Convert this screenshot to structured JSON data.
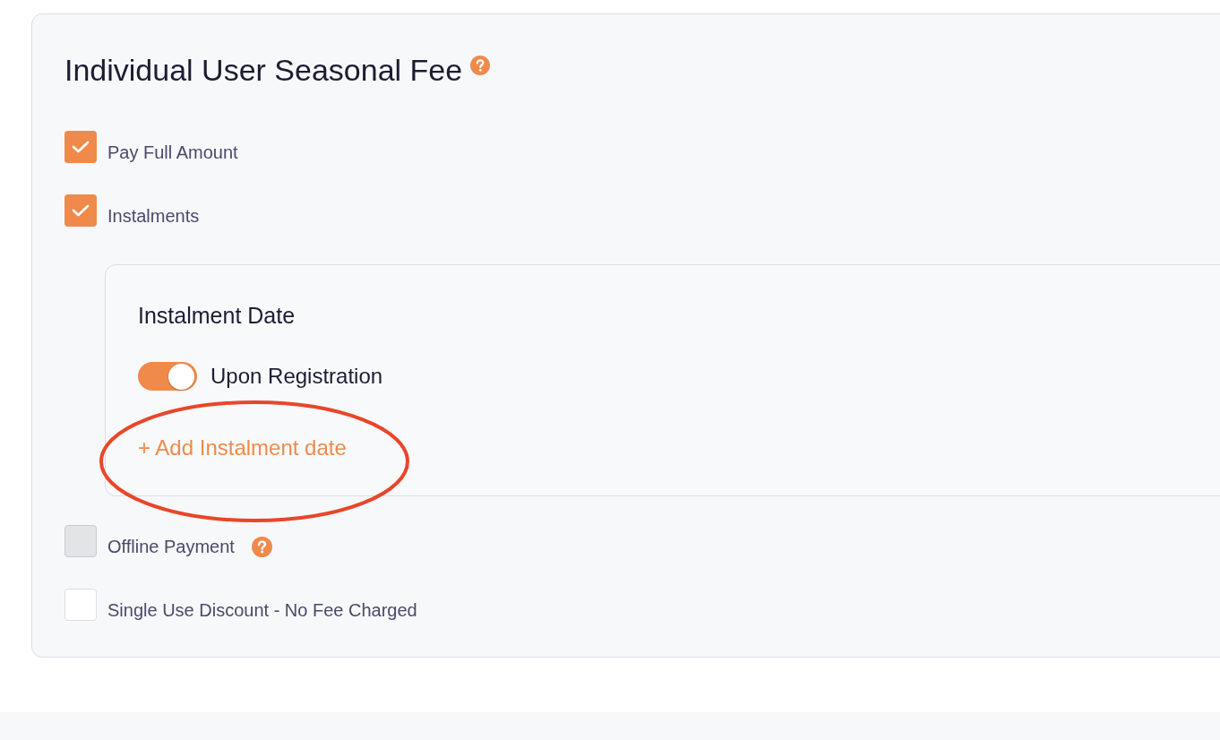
{
  "fee_section": {
    "title": "Individual User Seasonal Fee",
    "has_help": true
  },
  "options": [
    {
      "label": "Pay Full Amount",
      "checked": true,
      "disabled": false,
      "has_help": false
    },
    {
      "label": "Instalments",
      "checked": true,
      "disabled": false,
      "has_help": false,
      "instalment_panel": {
        "title": "Instalment Date",
        "dates": [
          {
            "label": "Upon Registration",
            "on": true
          }
        ],
        "add_link": "+ Add Instalment date"
      }
    },
    {
      "label": "Offline Payment",
      "checked": false,
      "disabled": true,
      "has_help": true
    },
    {
      "label": "Single Use Discount - No Fee Charged",
      "checked": false,
      "disabled": false,
      "has_help": false
    }
  ]
}
